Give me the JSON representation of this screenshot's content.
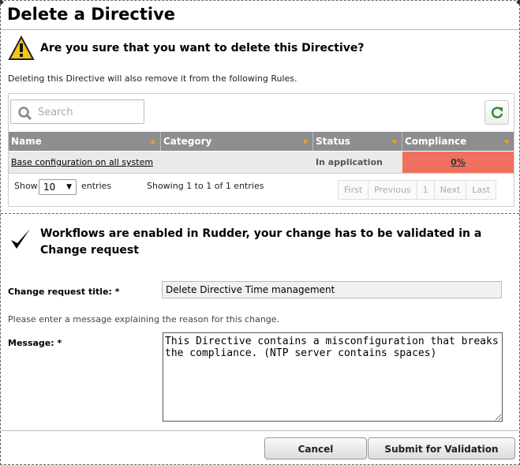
{
  "dialog": {
    "title": "Delete a Directive",
    "question": "Are you sure that you want to delete this Directive?",
    "info": "Deleting this Directive will also remove it from the following Rules."
  },
  "table": {
    "search_placeholder": "Search",
    "columns": [
      "Name",
      "Category",
      "Status",
      "Compliance"
    ],
    "rows": [
      {
        "name": "Base configuration on all system",
        "category": "",
        "status": "In application",
        "compliance": "0%"
      }
    ],
    "show_label": "Show",
    "page_size": "10",
    "entries_label": "entries",
    "showing_text": "Showing 1 to 1 of 1 entries",
    "pager": [
      "First",
      "Previous",
      "1",
      "Next",
      "Last"
    ]
  },
  "workflow": {
    "message": "Workflows are enabled in Rudder, your change has to be validated in a Change request"
  },
  "form": {
    "cr_title_label": "Change request title: *",
    "cr_title_value": "Delete Directive Time management",
    "hint": "Please enter a message explaining the reason for this change.",
    "message_label": "Message: *",
    "message_value": "This Directive contains a misconfiguration that breaks the compliance. (NTP server contains spaces)"
  },
  "buttons": {
    "cancel": "Cancel",
    "submit": "Submit for Validation"
  },
  "colors": {
    "compliance_bad": "#f07060",
    "header_bg": "#8e8e8e",
    "sort_arrow": "#f0a020",
    "refresh_green": "#2e8b3a"
  },
  "icons": [
    "warning-icon",
    "search-icon",
    "refresh-icon",
    "checkmark-icon",
    "sort-icon"
  ]
}
